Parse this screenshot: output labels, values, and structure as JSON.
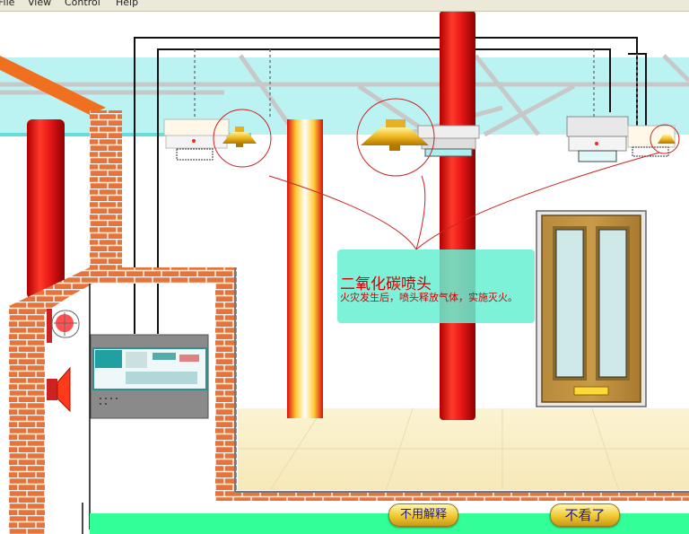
{
  "menu": {
    "file": "File",
    "view": "View",
    "control": "Control",
    "help": "Help"
  },
  "popup": {
    "title": "二氧化碳喷头",
    "description": "火灾发生后，喷头释放气体，实施灭火。"
  },
  "buttons": {
    "no_explain": "不用解释",
    "stop_watching": "不看了"
  },
  "colors": {
    "pillar_red": "#e01818",
    "brick": "#e8733a",
    "floor_green": "#33ff99",
    "glass_cyan": "#aaf0f0",
    "nozzle_gold": "#e8b020",
    "popup_bg": "#66f0d2",
    "popup_text": "#cc0000"
  },
  "icons": [
    "co2-nozzle-icon",
    "smoke-detector-icon",
    "alarm-bell-icon",
    "siren-icon",
    "fire-control-panel-icon",
    "door-icon"
  ]
}
